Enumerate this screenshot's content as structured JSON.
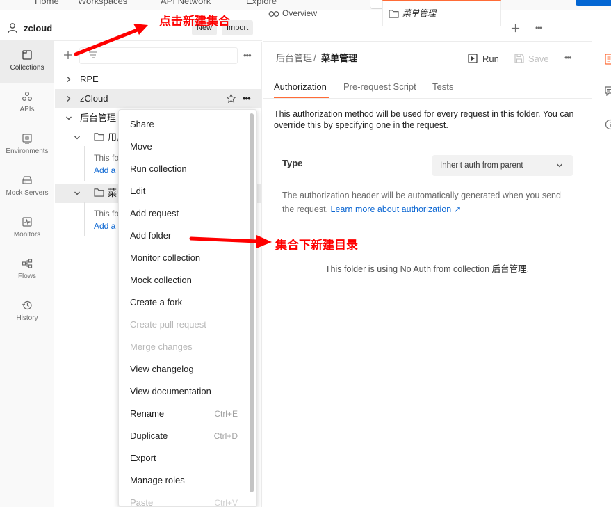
{
  "topbar": {
    "nav": [
      "Home",
      "Workspaces",
      "API Network",
      "Explore"
    ]
  },
  "workspace": {
    "name": "zcloud",
    "new_label": "New",
    "import_label": "Import"
  },
  "rail": {
    "items": [
      {
        "label": "Collections",
        "icon": "collections-icon"
      },
      {
        "label": "APIs",
        "icon": "apis-icon"
      },
      {
        "label": "Environments",
        "icon": "environments-icon"
      },
      {
        "label": "Mock Servers",
        "icon": "mock-servers-icon"
      },
      {
        "label": "Monitors",
        "icon": "monitors-icon"
      },
      {
        "label": "Flows",
        "icon": "flows-icon"
      },
      {
        "label": "History",
        "icon": "history-icon"
      }
    ]
  },
  "tree": {
    "items": [
      {
        "label": "RPE"
      },
      {
        "label": "zCloud"
      },
      {
        "label": "后台管理"
      },
      {
        "label": "用户"
      },
      {
        "label": "This fo"
      },
      {
        "label": "Add a"
      },
      {
        "label": "菜单"
      },
      {
        "label": "This fo"
      },
      {
        "label": "Add a"
      }
    ]
  },
  "menu": {
    "items": [
      {
        "label": "Share",
        "shortcut": "",
        "disabled": false
      },
      {
        "label": "Move",
        "shortcut": "",
        "disabled": false
      },
      {
        "label": "Run collection",
        "shortcut": "",
        "disabled": false
      },
      {
        "label": "Edit",
        "shortcut": "",
        "disabled": false
      },
      {
        "label": "Add request",
        "shortcut": "",
        "disabled": false
      },
      {
        "label": "Add folder",
        "shortcut": "",
        "disabled": false
      },
      {
        "label": "Monitor collection",
        "shortcut": "",
        "disabled": false
      },
      {
        "label": "Mock collection",
        "shortcut": "",
        "disabled": false
      },
      {
        "label": "Create a fork",
        "shortcut": "",
        "disabled": false
      },
      {
        "label": "Create pull request",
        "shortcut": "",
        "disabled": true
      },
      {
        "label": "Merge changes",
        "shortcut": "",
        "disabled": true
      },
      {
        "label": "View changelog",
        "shortcut": "",
        "disabled": false
      },
      {
        "label": "View documentation",
        "shortcut": "",
        "disabled": false
      },
      {
        "label": "Rename",
        "shortcut": "Ctrl+E",
        "disabled": false
      },
      {
        "label": "Duplicate",
        "shortcut": "Ctrl+D",
        "disabled": false
      },
      {
        "label": "Export",
        "shortcut": "",
        "disabled": false
      },
      {
        "label": "Manage roles",
        "shortcut": "",
        "disabled": false
      },
      {
        "label": "Paste",
        "shortcut": "Ctrl+V",
        "disabled": true
      }
    ]
  },
  "tabs": {
    "overview": "Overview",
    "active": "菜单管理"
  },
  "main": {
    "breadcrumb_parent": "后台管理",
    "breadcrumb_sep": "/",
    "title": "菜单管理",
    "run_label": "Run",
    "save_label": "Save",
    "subtabs": [
      "Authorization",
      "Pre-request Script",
      "Tests"
    ],
    "description": "This authorization method will be used for every request in this folder. You can override this by specifying one in the request.",
    "type_label": "Type",
    "auth_value": "Inherit auth from parent",
    "auth_note": "The authorization header will be automatically generated when you send the request.",
    "auth_link": "Learn more about authorization ↗",
    "noauth_text": "This folder is using No Auth from collection",
    "noauth_collection": "后台管理",
    "noauth_end": "."
  },
  "annotations": {
    "new_collection": "点击新建集合",
    "new_folder": "集合下新建目录"
  },
  "colors": {
    "accent": "#ff6c37",
    "link": "#0b66d2",
    "annotation": "#ff0000"
  }
}
